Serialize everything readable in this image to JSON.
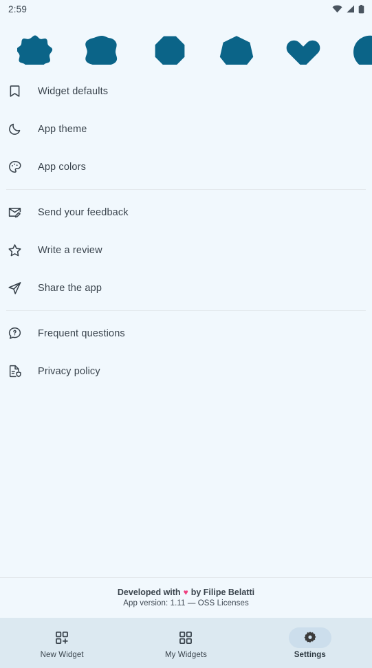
{
  "theme": {
    "background": "#f1f8fd",
    "shape_color": "#0b6488",
    "text_color": "#39434c",
    "divider_color": "#e3e8ec",
    "navbar_background": "#dce9f1",
    "nav_pill_active": "#ccdeec",
    "heart_color": "#ef3f7f"
  },
  "statusbar": {
    "clock": "2:59",
    "icons": [
      {
        "name": "wifi-icon"
      },
      {
        "name": "cellular-signal-icon"
      },
      {
        "name": "battery-icon"
      }
    ]
  },
  "shapes_header": {
    "shapes": [
      {
        "name": "scalloped-star-shape"
      },
      {
        "name": "clover-blob-shape"
      },
      {
        "name": "octagon-shape"
      },
      {
        "name": "heptagon-shape"
      },
      {
        "name": "heart-shape"
      },
      {
        "name": "blob-shape-clipped"
      }
    ]
  },
  "menu": {
    "groups": [
      {
        "items": [
          {
            "icon": "bookmark-icon",
            "label": "Widget defaults"
          },
          {
            "icon": "moon-icon",
            "label": "App theme"
          },
          {
            "icon": "palette-icon",
            "label": "App colors"
          }
        ]
      },
      {
        "items": [
          {
            "icon": "mail-edit-icon",
            "label": "Send your feedback"
          },
          {
            "icon": "star-icon",
            "label": "Write a review"
          },
          {
            "icon": "send-icon",
            "label": "Share the app"
          }
        ]
      },
      {
        "items": [
          {
            "icon": "question-bubble-icon",
            "label": "Frequent questions"
          },
          {
            "icon": "document-shield-icon",
            "label": "Privacy policy"
          }
        ]
      }
    ]
  },
  "footer": {
    "developed_prefix": "Developed with",
    "heart": "♥",
    "developed_suffix": "by Filipe Belatti",
    "version_line": "App version: 1.11  —  OSS Licenses"
  },
  "navbar": {
    "items": [
      {
        "icon": "add-widget-icon",
        "label": "New Widget",
        "selected": false
      },
      {
        "icon": "grid-widgets-icon",
        "label": "My Widgets",
        "selected": false
      },
      {
        "icon": "gear-icon",
        "label": "Settings",
        "selected": true
      }
    ]
  }
}
